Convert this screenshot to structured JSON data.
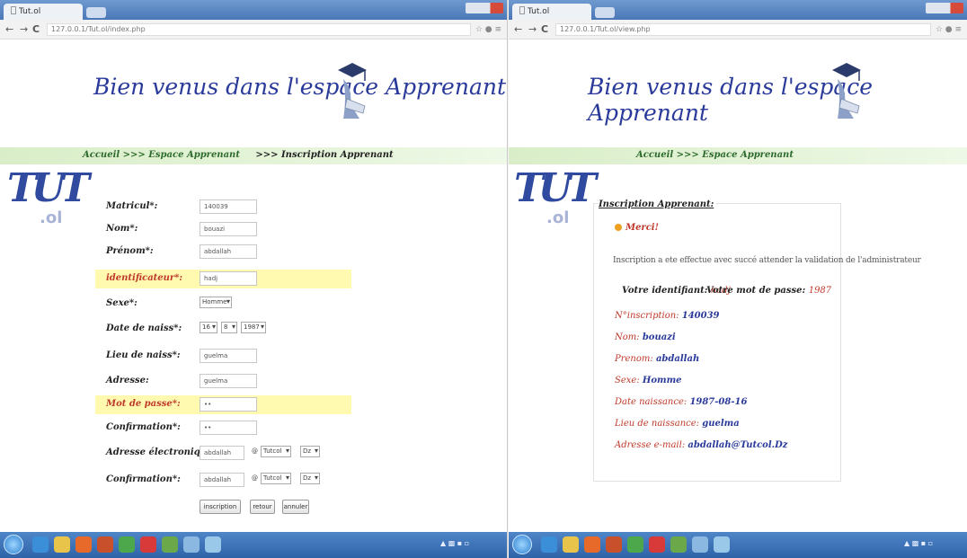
{
  "left_window": {
    "tab_title": "Tut.ol",
    "address": "127.0.0.1/Tut.ol/index.php",
    "page_title": "Bien venus dans l'espace Apprenant",
    "breadcrumb": {
      "home": "Accueil",
      "sep1": ">>>",
      "section": "Espace Apprenant",
      "sep2": ">>>",
      "current": "Inscription Apprenant"
    },
    "logo": {
      "text": "TUT",
      "sub": ".ol"
    },
    "form": {
      "matricule": {
        "label": "Matricul*:",
        "value": "140039"
      },
      "nom": {
        "label": "Nom*:",
        "value": "bouazi"
      },
      "prenom": {
        "label": "Prénom*:",
        "value": "abdallah"
      },
      "identificateur": {
        "label": "identificateur*:",
        "value": "hadj"
      },
      "sexe": {
        "label": "Sexe*:",
        "value": "Homme"
      },
      "date_naiss": {
        "label": "Date de naiss*:",
        "day": "16",
        "month": "8",
        "year": "1987"
      },
      "lieu_naiss": {
        "label": "Lieu de naiss*:",
        "value": "guelma"
      },
      "adresse": {
        "label": "Adresse:",
        "value": "guelma"
      },
      "mot_de_passe": {
        "label": "Mot de passe*:",
        "value": "••"
      },
      "confirmation1": {
        "label": "Confirmation*:",
        "value": "••"
      },
      "email": {
        "label": "Adresse électronique*:",
        "value": "abdallah",
        "at": "@",
        "domain": "Tutcol",
        "ext": "Dz"
      },
      "confirmation2": {
        "label": "Confirmation*:",
        "value": "abdallah",
        "at": "@",
        "domain": "Tutcol",
        "ext": "Dz"
      }
    },
    "buttons": {
      "inscription": "inscription",
      "retour": "retour",
      "annuler": "annuler"
    }
  },
  "right_window": {
    "tab_title": "Tut.ol",
    "address": "127.0.0.1/Tut.ol/view.php",
    "page_title": "Bien venus dans l'espace Apprenant",
    "breadcrumb": {
      "home": "Accueil",
      "sep1": ">>>",
      "section": "Espace Apprenant"
    },
    "logo": {
      "text": "TUT",
      "sub": ".ol"
    },
    "box_title": "Inscription Apprenant:",
    "merci": "Merci!",
    "message": "Inscription a ete effectue avec succé attender la validation de l'administrateur",
    "identifiant_label": "Votre identifiant:",
    "identifiant_value": "hadj",
    "password_label": "Votre mot de passe:",
    "password_value": "1987",
    "details": [
      {
        "key": "N°inscription:",
        "value": "140039"
      },
      {
        "key": "Nom:",
        "value": "bouazi"
      },
      {
        "key": "Prenom:",
        "value": "abdallah"
      },
      {
        "key": "Sexe:",
        "value": "Homme"
      },
      {
        "key": "Date naissance:",
        "value": "1987-08-16"
      },
      {
        "key": "Lieu de naissance:",
        "value": "guelma"
      },
      {
        "key": "Adresse e-mail:",
        "value": "abdallah@Tutcol.Dz"
      }
    ]
  },
  "colors": {
    "title_blue": "#2a3a9a",
    "highlight": "#fffab0",
    "error_red": "#c0392b",
    "bread_green": "#d9eec8"
  }
}
